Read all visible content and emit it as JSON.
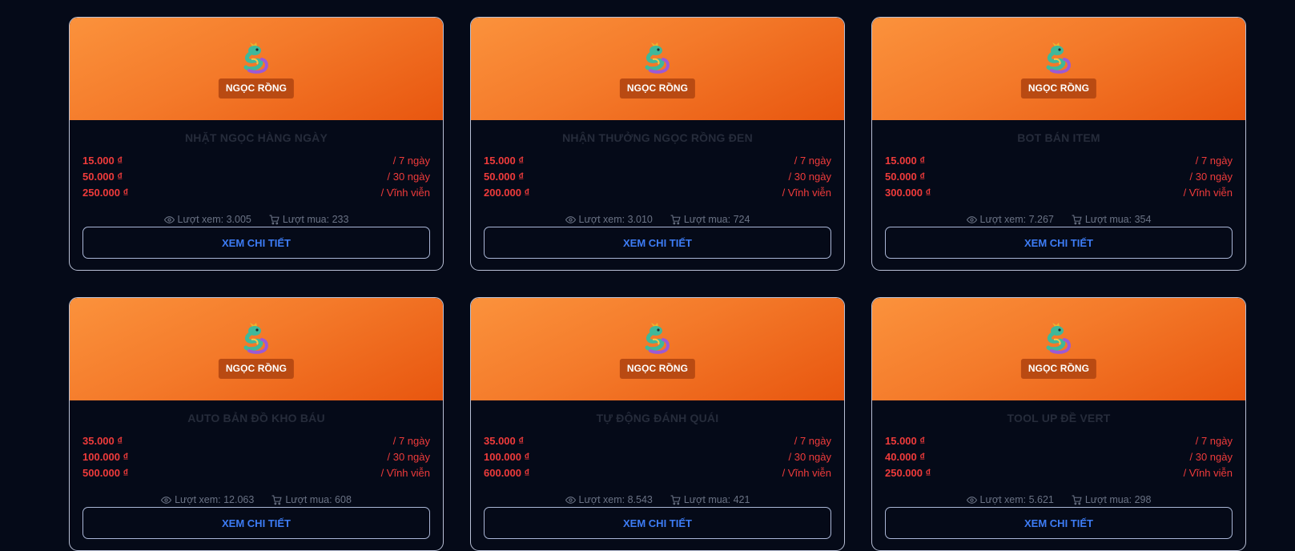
{
  "colors": {
    "background": "#050a18",
    "accent_orange": "#f47a2a",
    "price_red": "#ef3b3b",
    "button_blue": "#3d7cf5"
  },
  "icons": {
    "card_icon": "dragon-icon",
    "views_icon": "eye-icon",
    "purchases_icon": "cart-icon"
  },
  "cards": [
    {
      "tag": "NGỌC RỒNG",
      "title": "NHẶT NGỌC HÀNG NGÀY",
      "prices": [
        {
          "amount": "15.000 ₫",
          "period": "/ 7 ngày"
        },
        {
          "amount": "50.000 ₫",
          "period": "/ 30 ngày"
        },
        {
          "amount": "250.000 ₫",
          "period": "/ Vĩnh viễn"
        }
      ],
      "views": "Lượt xem: 3.005",
      "purchases": "Lượt mua: 233",
      "button": "XEM CHI TIẾT"
    },
    {
      "tag": "NGỌC RỒNG",
      "title": "NHẬN THƯỞNG NGỌC RỒNG ĐEN",
      "prices": [
        {
          "amount": "15.000 ₫",
          "period": "/ 7 ngày"
        },
        {
          "amount": "50.000 ₫",
          "period": "/ 30 ngày"
        },
        {
          "amount": "200.000 ₫",
          "period": "/ Vĩnh viễn"
        }
      ],
      "views": "Lượt xem: 3.010",
      "purchases": "Lượt mua: 724",
      "button": "XEM CHI TIẾT"
    },
    {
      "tag": "NGỌC RỒNG",
      "title": "BOT BÁN ITEM",
      "prices": [
        {
          "amount": "15.000 ₫",
          "period": "/ 7 ngày"
        },
        {
          "amount": "50.000 ₫",
          "period": "/ 30 ngày"
        },
        {
          "amount": "300.000 ₫",
          "period": "/ Vĩnh viễn"
        }
      ],
      "views": "Lượt xem: 7.267",
      "purchases": "Lượt mua: 354",
      "button": "XEM CHI TIẾT"
    },
    {
      "tag": "NGỌC RỒNG",
      "title": "AUTO BẢN ĐỒ KHO BÁU",
      "prices": [
        {
          "amount": "35.000 ₫",
          "period": "/ 7 ngày"
        },
        {
          "amount": "100.000 ₫",
          "period": "/ 30 ngày"
        },
        {
          "amount": "500.000 ₫",
          "period": "/ Vĩnh viễn"
        }
      ],
      "views": "Lượt xem: 12.063",
      "purchases": "Lượt mua: 608",
      "button": "XEM CHI TIẾT"
    },
    {
      "tag": "NGỌC RỒNG",
      "title": "TỰ ĐỘNG ĐÁNH QUÁI",
      "prices": [
        {
          "amount": "35.000 ₫",
          "period": "/ 7 ngày"
        },
        {
          "amount": "100.000 ₫",
          "period": "/ 30 ngày"
        },
        {
          "amount": "600.000 ₫",
          "period": "/ Vĩnh viễn"
        }
      ],
      "views": "Lượt xem: 8.543",
      "purchases": "Lượt mua: 421",
      "button": "XEM CHI TIẾT"
    },
    {
      "tag": "NGỌC RỒNG",
      "title": "TOOL UP ĐỀ VERT",
      "prices": [
        {
          "amount": "15.000 ₫",
          "period": "/ 7 ngày"
        },
        {
          "amount": "40.000 ₫",
          "period": "/ 30 ngày"
        },
        {
          "amount": "250.000 ₫",
          "period": "/ Vĩnh viễn"
        }
      ],
      "views": "Lượt xem: 5.621",
      "purchases": "Lượt mua: 298",
      "button": "XEM CHI TIẾT"
    }
  ]
}
